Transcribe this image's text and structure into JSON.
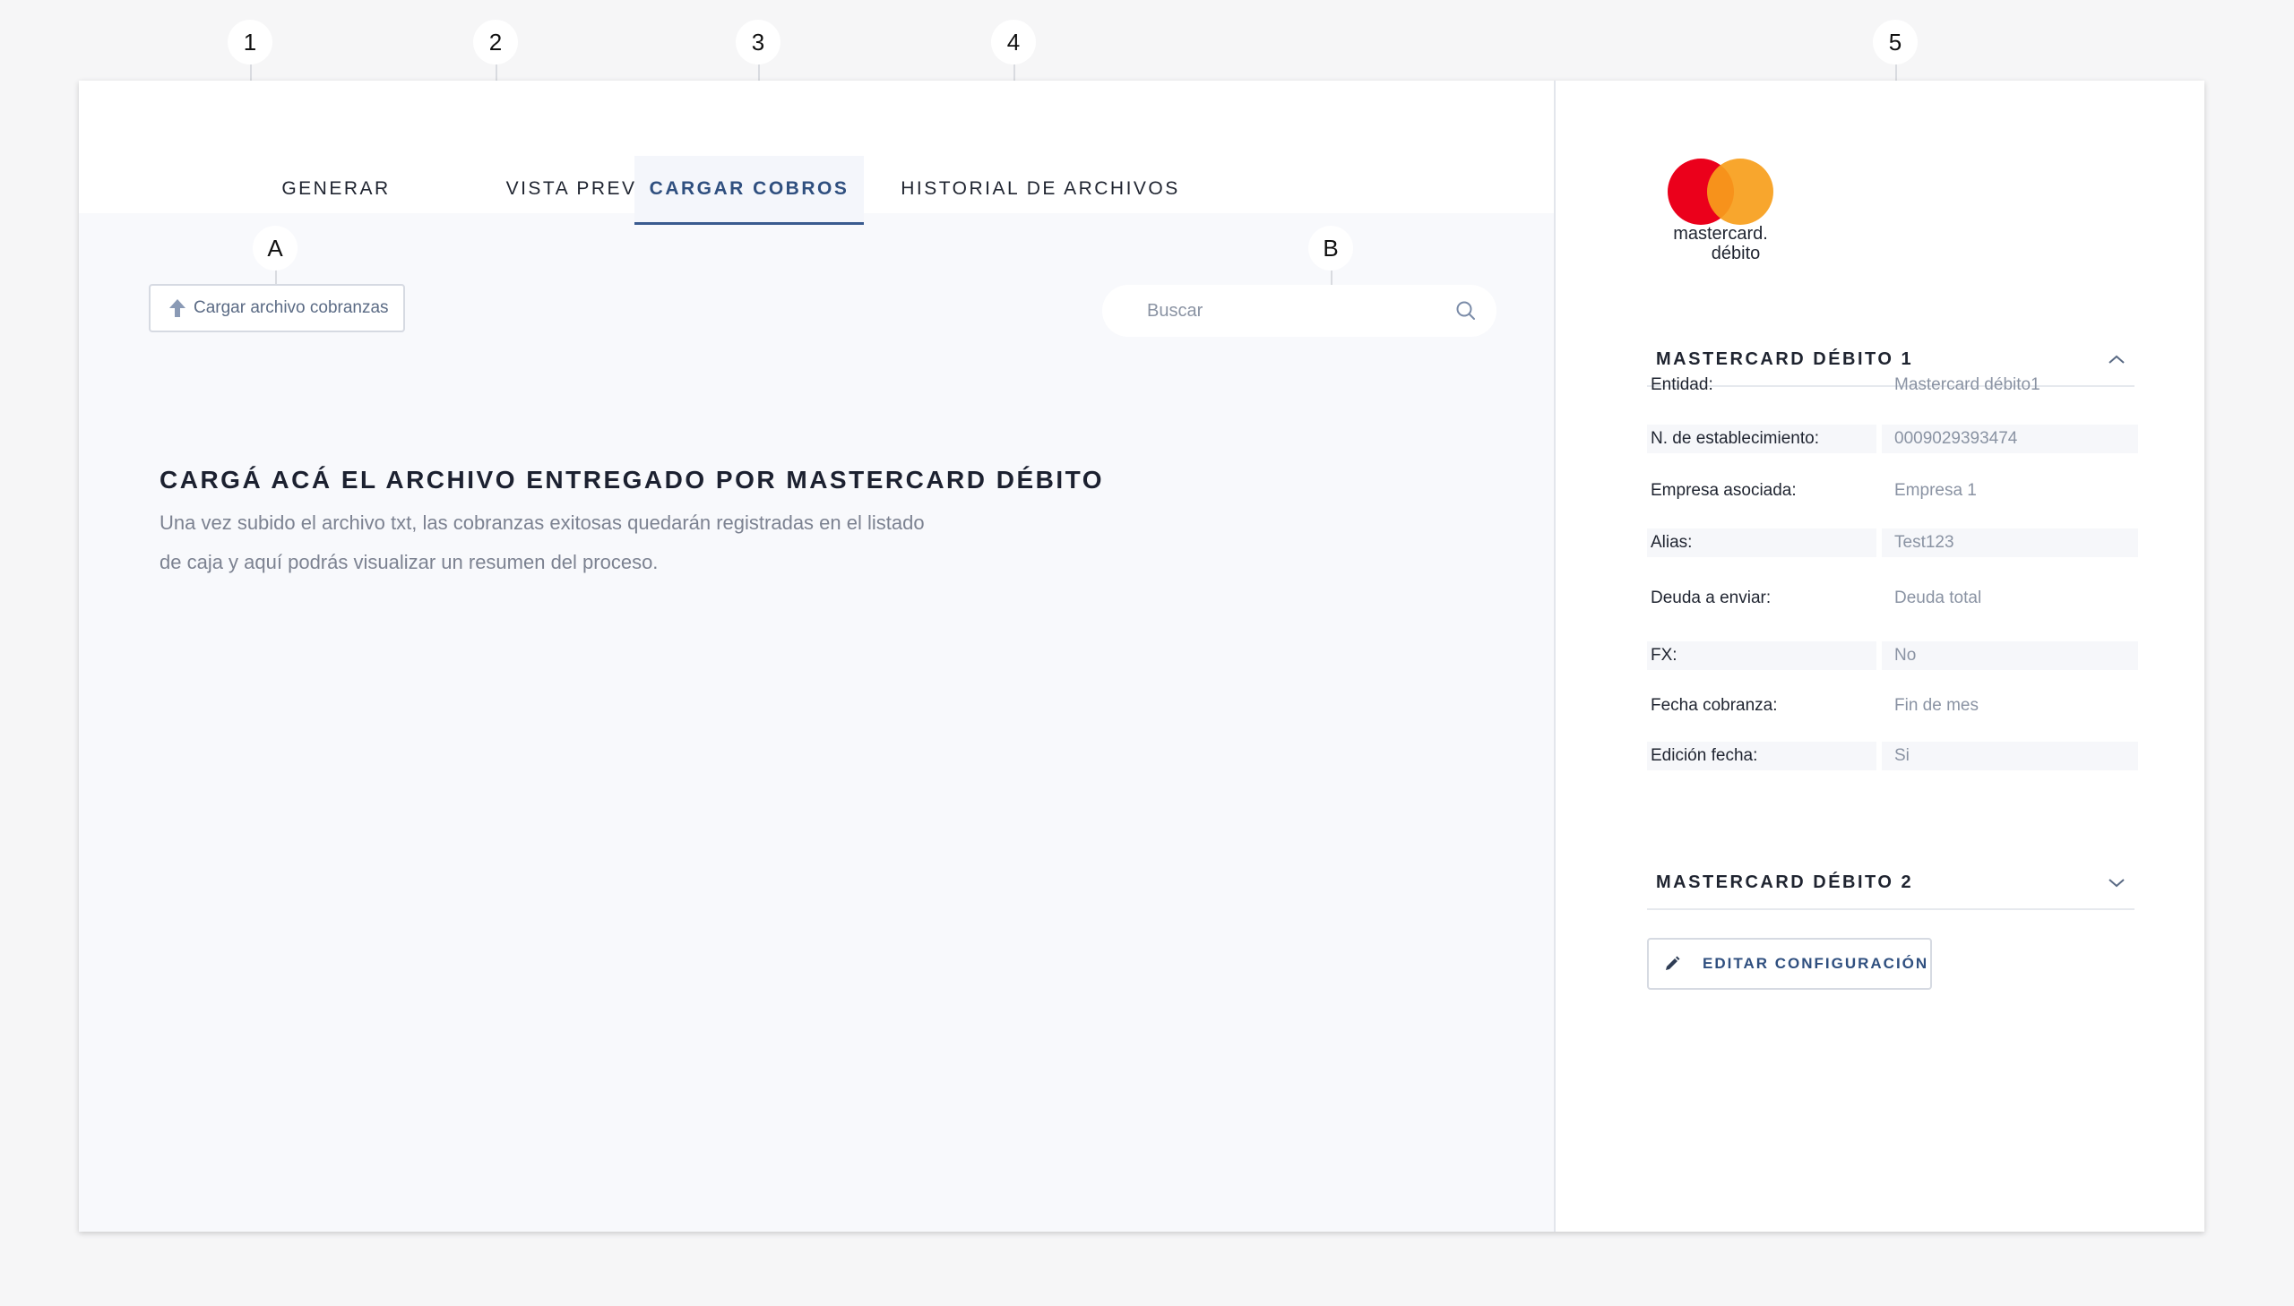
{
  "callouts": [
    "1",
    "2",
    "3",
    "4",
    "5",
    "A",
    "B"
  ],
  "tabs": [
    {
      "label": "GENERAR"
    },
    {
      "label": "VISTA PREVIA"
    },
    {
      "label": "CARGAR COBROS"
    },
    {
      "label": "HISTORIAL DE ARCHIVOS"
    }
  ],
  "toolbar": {
    "upload_label": "Cargar archivo cobranzas",
    "search_placeholder": "Buscar"
  },
  "content": {
    "headline": "CARGÁ ACÁ EL ARCHIVO ENTREGADO POR MASTERCARD DÉBITO",
    "description": "Una vez subido el archivo txt, las cobranzas exitosas quedarán registradas en el listado de caja y aquí podrás visualizar un resumen del proceso."
  },
  "brand": {
    "logo_line1": "mastercard.",
    "logo_line2": "débito",
    "red": "#eb001b",
    "orange": "#f79e1b",
    "overlap": "#ff5f00"
  },
  "config": {
    "accordion1_title": "MASTERCARD DÉBITO 1",
    "accordion2_title": "MASTERCARD DÉBITO 2",
    "fields": [
      {
        "label": "Entidad:",
        "value": "Mastercard débito1"
      },
      {
        "label": "N. de establecimiento:",
        "value": "0009029393474"
      },
      {
        "label": "Empresa asociada:",
        "value": "Empresa 1"
      },
      {
        "label": "Alias:",
        "value": "Test123"
      },
      {
        "label": "Deuda a enviar:",
        "value": "Deuda total"
      },
      {
        "label": "FX:",
        "value": "No"
      },
      {
        "label": "Fecha cobranza:",
        "value": "Fin de mes"
      },
      {
        "label": "Edición fecha:",
        "value": "Si"
      }
    ],
    "edit_label": "EDITAR CONFIGURACIÓN"
  }
}
